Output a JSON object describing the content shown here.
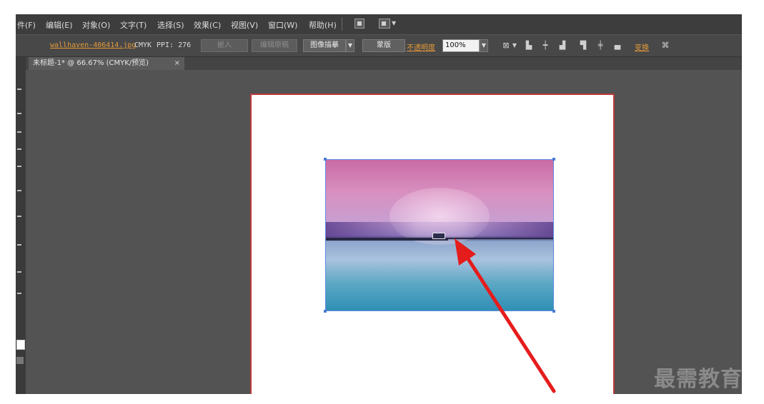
{
  "menubar": {
    "items": [
      "件(F)",
      "编辑(E)",
      "对象(O)",
      "文字(T)",
      "选择(S)",
      "效果(C)",
      "视图(V)",
      "窗口(W)",
      "帮助(H)"
    ]
  },
  "control_bar": {
    "file_name": "wallhaven-406414.jpg",
    "color_mode": "CMYK",
    "ppi_label": "PPI: 276",
    "embed_button": "嵌入",
    "edit_original_button": "编辑原稿",
    "image_trace_button": "图像描摹",
    "mask_button": "蒙版",
    "opacity_label": "不透明度",
    "opacity_value": "100%",
    "transform_link": "变换"
  },
  "document": {
    "tab_title": "未标题-1* @ 66.67% (CMYK/预览)",
    "tab_close": "×"
  },
  "watermark": "最需教育",
  "colors": {
    "artboard_border": "#b83a3a",
    "selection": "#4a7bd6",
    "annotation_arrow": "#e51c1c",
    "link_orange": "#e49a3a"
  }
}
